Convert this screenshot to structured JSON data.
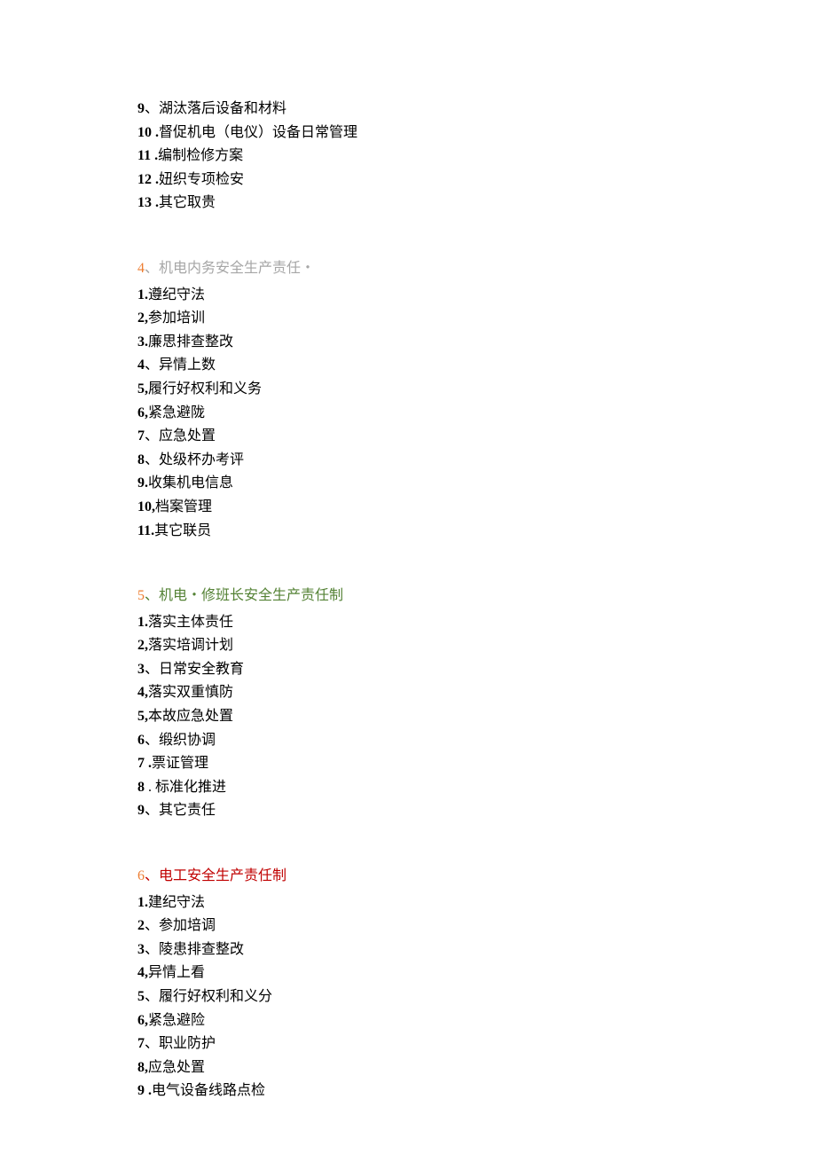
{
  "section0": {
    "items": [
      {
        "num": "9",
        "sep": "、",
        "text": "湖汰落后设备和材料"
      },
      {
        "num": "10",
        "sep": " .",
        "text": "督促机电（电仪）设备日常管理"
      },
      {
        "num": "11",
        "sep": " .",
        "text": "编制检修方案"
      },
      {
        "num": "12",
        "sep": " .",
        "text": "妞织专项检安"
      },
      {
        "num": "13",
        "sep": " .",
        "text": "其它取贵"
      }
    ]
  },
  "section4": {
    "heading": {
      "num": "4",
      "sep": "、",
      "text": "机电内务安全生产责任・"
    },
    "items": [
      {
        "num": "1.",
        "sep": "",
        "text": "遵纪守法"
      },
      {
        "num": "2,",
        "sep": "",
        "text": "参加培训"
      },
      {
        "num": "3.",
        "sep": "",
        "text": "廉思排查整改"
      },
      {
        "num": "4",
        "sep": "、",
        "text": "异情上数"
      },
      {
        "num": "5,",
        "sep": "",
        "text": "履行好权利和义务"
      },
      {
        "num": "6,",
        "sep": "",
        "text": "紧急避陇"
      },
      {
        "num": "7",
        "sep": "、",
        "text": "应急处置"
      },
      {
        "num": "8",
        "sep": "、",
        "text": "处级杯办考评"
      },
      {
        "num": "9.",
        "sep": "",
        "text": "收集机电信息"
      },
      {
        "num": "10,",
        "sep": "",
        "text": "档案管理"
      },
      {
        "num": "11.",
        "sep": "",
        "text": "其它联员"
      }
    ]
  },
  "section5": {
    "heading": {
      "num": "5",
      "sep": "、",
      "text": "机电・修班长安全生产责任制"
    },
    "items": [
      {
        "num": "1.",
        "sep": "",
        "text": "落实主体责任"
      },
      {
        "num": "2,",
        "sep": "",
        "text": "落实培调计划"
      },
      {
        "num": "3",
        "sep": "、",
        "text": "日常安全教育"
      },
      {
        "num": "4,",
        "sep": "",
        "text": "落实双重慎防"
      },
      {
        "num": "5,",
        "sep": "",
        "text": "本故应急处置"
      },
      {
        "num": "6",
        "sep": "、",
        "text": "缎织协调"
      },
      {
        "num": "7",
        "sep": " .",
        "text": "票证管理"
      },
      {
        "num": "8",
        "sep": " . ",
        "text": "标准化推进"
      },
      {
        "num": "9",
        "sep": "、",
        "text": "其它责任"
      }
    ]
  },
  "section6": {
    "heading": {
      "num": "6",
      "sep": "、",
      "text": "电工安全生产责任制"
    },
    "items": [
      {
        "num": "1.",
        "sep": "",
        "text": "建纪守法"
      },
      {
        "num": "2",
        "sep": "、",
        "text": "参加培调"
      },
      {
        "num": "3",
        "sep": "、",
        "text": "陵患排查整改"
      },
      {
        "num": "4,",
        "sep": "",
        "text": "异情上看"
      },
      {
        "num": "5",
        "sep": "、",
        "text": "履行好权利和义分"
      },
      {
        "num": "6,",
        "sep": "",
        "text": "紧急避险"
      },
      {
        "num": "7",
        "sep": "、",
        "text": "职业防护"
      },
      {
        "num": "8,",
        "sep": "",
        "text": "应急处置"
      },
      {
        "num": "9",
        "sep": " .",
        "text": "电气设备线路点检"
      }
    ]
  }
}
